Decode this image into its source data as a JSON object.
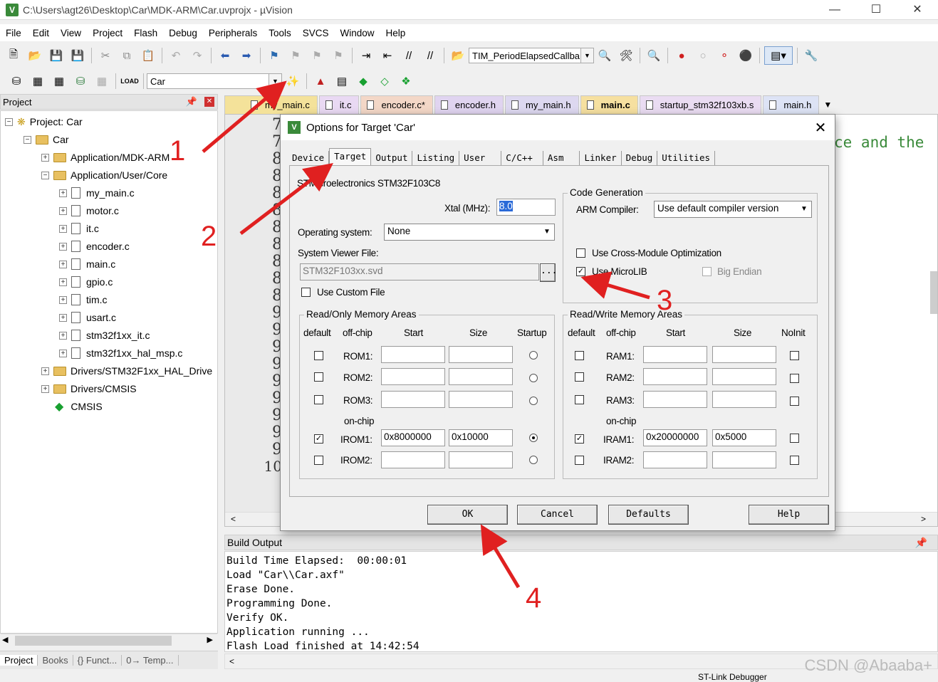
{
  "window": {
    "title": "C:\\Users\\agt26\\Desktop\\Car\\MDK-ARM\\Car.uvprojx - µVision"
  },
  "menu": [
    "File",
    "Edit",
    "View",
    "Project",
    "Flash",
    "Debug",
    "Peripherals",
    "Tools",
    "SVCS",
    "Window",
    "Help"
  ],
  "toolbar": {
    "function_combo": "TIM_PeriodElapsedCallba",
    "target_combo": "Car"
  },
  "project_panel": {
    "title": "Project",
    "root": "Project: Car",
    "target": "Car",
    "groups": [
      "Application/MDK-ARM",
      "Application/User/Core"
    ],
    "files": [
      "my_main.c",
      "motor.c",
      "it.c",
      "encoder.c",
      "main.c",
      "gpio.c",
      "tim.c",
      "usart.c",
      "stm32f1xx_it.c",
      "stm32f1xx_hal_msp.c"
    ],
    "groups2": [
      "Drivers/STM32F1xx_HAL_Drive",
      "Drivers/CMSIS"
    ],
    "cmsis": "CMSIS",
    "tabs": [
      "Project",
      "Books",
      "{} Funct...",
      "0→ Temp..."
    ]
  },
  "editor_tabs": [
    "my_main.c",
    "it.c",
    "encoder.c*",
    "encoder.h",
    "my_main.h",
    "main.c",
    "startup_stm32f103xb.s",
    "main.h"
  ],
  "editor": {
    "line_numbers": [
      "7",
      "7",
      "8",
      "8",
      "8",
      "8",
      "8",
      "8",
      "8",
      "8",
      "8",
      "9",
      "9",
      "9",
      "9",
      "9",
      "9",
      "9",
      "9",
      "9",
      "10"
    ],
    "code_fragment": "ce and the"
  },
  "build_output": {
    "title": "Build Output",
    "lines": [
      "Build Time Elapsed:  00:00:01",
      "Load \"Car\\\\Car.axf\"",
      "Erase Done.",
      "Programming Done.",
      "Verify OK.",
      "Application running ...",
      "Flash Load finished at 14:42:54"
    ]
  },
  "dialog": {
    "title": "Options for Target 'Car'",
    "tabs": [
      "Device",
      "Target",
      "Output",
      "Listing",
      "User",
      "C/C++",
      "Asm",
      "Linker",
      "Debug",
      "Utilities"
    ],
    "device": "STMicroelectronics STM32F103C8",
    "xtal_label": "Xtal (MHz):",
    "xtal_value": "8.0",
    "os_label": "Operating system:",
    "os_value": "None",
    "svd_label": "System Viewer File:",
    "svd_value": "STM32F103xx.svd",
    "custom_file": "Use Custom File",
    "codegen_title": "Code Generation",
    "compiler_label": "ARM Compiler:",
    "compiler_value": "Use default compiler version",
    "cross_module": "Use Cross-Module Optimization",
    "microlib": "Use MicroLIB",
    "big_endian": "Big Endian",
    "ro_title": "Read/Only Memory Areas",
    "rw_title": "Read/Write Memory Areas",
    "hdr_default": "default",
    "hdr_offchip": "off-chip",
    "hdr_start": "Start",
    "hdr_size": "Size",
    "hdr_startup": "Startup",
    "hdr_noinit": "NoInit",
    "onchip": "on-chip",
    "rom": [
      {
        "name": "ROM1:",
        "start": "",
        "size": ""
      },
      {
        "name": "ROM2:",
        "start": "",
        "size": ""
      },
      {
        "name": "ROM3:",
        "start": "",
        "size": ""
      },
      {
        "name": "IROM1:",
        "start": "0x8000000",
        "size": "0x10000"
      },
      {
        "name": "IROM2:",
        "start": "",
        "size": ""
      }
    ],
    "ram": [
      {
        "name": "RAM1:",
        "start": "",
        "size": ""
      },
      {
        "name": "RAM2:",
        "start": "",
        "size": ""
      },
      {
        "name": "RAM3:",
        "start": "",
        "size": ""
      },
      {
        "name": "IRAM1:",
        "start": "0x20000000",
        "size": "0x5000"
      },
      {
        "name": "IRAM2:",
        "start": "",
        "size": ""
      }
    ],
    "buttons": {
      "ok": "OK",
      "cancel": "Cancel",
      "defaults": "Defaults",
      "help": "Help"
    }
  },
  "annotations": [
    "1",
    "2",
    "3",
    "4"
  ],
  "status": {
    "debugger": "ST-Link Debugger"
  },
  "watermark": "CSDN @Abaaba+"
}
